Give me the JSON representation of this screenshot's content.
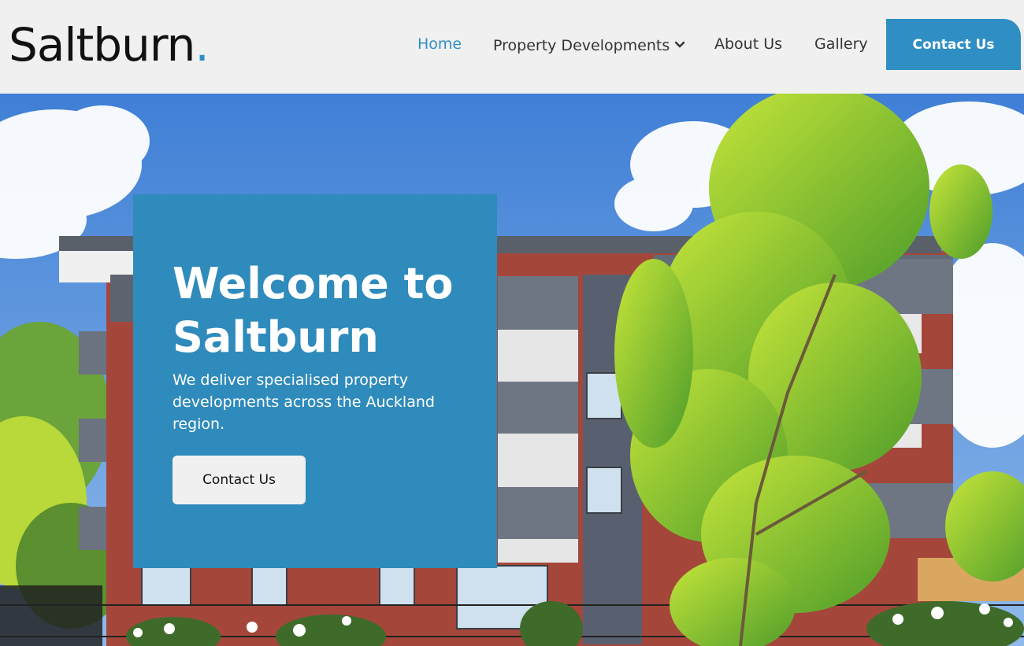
{
  "brand": {
    "name": "Saltburn",
    "dot": ".",
    "accent": "#2f8fc4"
  },
  "nav": {
    "items": [
      {
        "label": "Home",
        "active": true
      },
      {
        "label": "Property Developments",
        "active": false,
        "has_dropdown": true
      },
      {
        "label": "About Us",
        "active": false
      },
      {
        "label": "Gallery",
        "active": false
      }
    ],
    "cta_label": "Contact Us"
  },
  "hero": {
    "title": "Welcome to Saltburn",
    "subtitle": "We deliver specialised property developments across the Auckland region.",
    "button_label": "Contact Us",
    "card_color": "#2f8bbb"
  }
}
